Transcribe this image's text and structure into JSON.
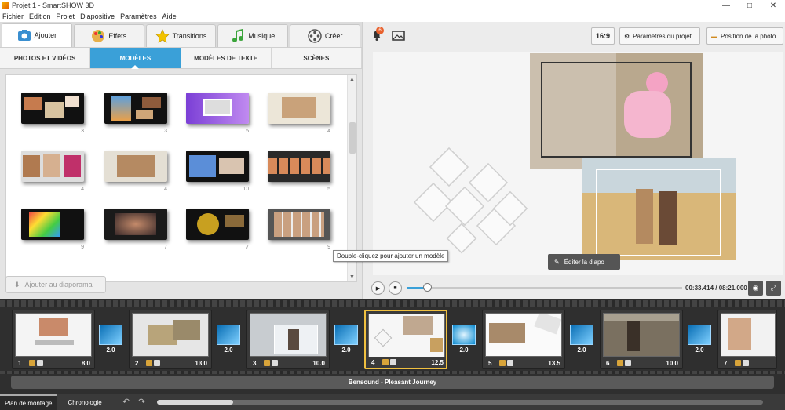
{
  "window": {
    "title": "Projet 1 - SmartSHOW 3D",
    "controls": [
      "—",
      "□",
      "✕"
    ]
  },
  "menu": [
    "Fichier",
    "Édition",
    "Projet",
    "Diapositive",
    "Paramètres",
    "Aide"
  ],
  "main_tabs": [
    {
      "label": "Ajouter",
      "icon": "add-photo-icon",
      "active": true
    },
    {
      "label": "Effets",
      "icon": "palette-icon"
    },
    {
      "label": "Transitions",
      "icon": "star-icon"
    },
    {
      "label": "Musique",
      "icon": "music-note-icon"
    },
    {
      "label": "Créer",
      "icon": "film-reel-icon"
    }
  ],
  "sub_tabs": [
    {
      "label": "PHOTOS ET VIDÉOS"
    },
    {
      "label": "MODÈLES",
      "active": true
    },
    {
      "label": "MODÈLES DE TEXTE"
    },
    {
      "label": "SCÈNES"
    }
  ],
  "templates": [
    {
      "count": "3"
    },
    {
      "count": "3"
    },
    {
      "count": "5"
    },
    {
      "count": "4"
    },
    {
      "count": "4"
    },
    {
      "count": "4"
    },
    {
      "count": "10"
    },
    {
      "count": "5"
    },
    {
      "count": "9"
    },
    {
      "count": "7"
    },
    {
      "count": "7"
    },
    {
      "count": "9"
    }
  ],
  "add_button": {
    "label": "Ajouter au diaporama"
  },
  "tooltip": "Double-cliquez pour ajouter un modèle",
  "notifications": {
    "count": "6"
  },
  "toolbar": {
    "aspect": "16:9",
    "project_params": "Paramètres du projet",
    "photo_position": "Position de la photo"
  },
  "preview": {
    "edit_label": "Éditer la diapo"
  },
  "player": {
    "time": "00:33.414 / 08:21.000",
    "progress_fraction": 0.07
  },
  "timeline": {
    "slides": [
      {
        "num": "1",
        "dur": "8.0"
      },
      {
        "num": "2",
        "dur": "13.0"
      },
      {
        "num": "3",
        "dur": "10.0"
      },
      {
        "num": "4",
        "dur": "12.5",
        "active": true
      },
      {
        "num": "5",
        "dur": "13.5"
      },
      {
        "num": "6",
        "dur": "10.0"
      },
      {
        "num": "7",
        "dur": ""
      }
    ],
    "transitions": [
      "2.0",
      "2.0",
      "2.0",
      "2.0",
      "2.0",
      "2.0"
    ],
    "music": "Bensound - Pleasant Journey"
  },
  "bottom_tabs": [
    {
      "label": "Plan de montage",
      "active": true
    },
    {
      "label": "Chronologie"
    }
  ]
}
